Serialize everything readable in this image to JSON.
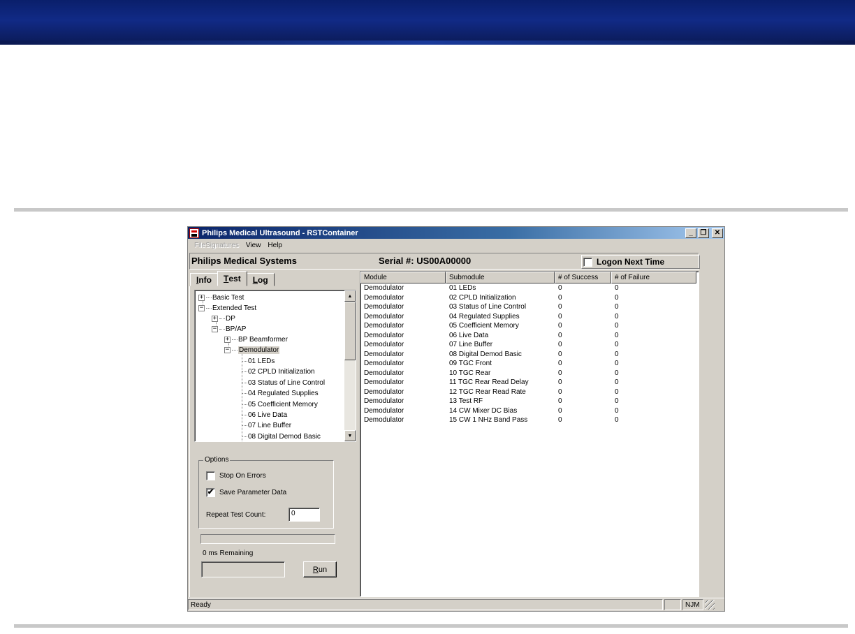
{
  "window": {
    "title": "Philips Medical Ultrasound - RSTContainer",
    "minimize": "_",
    "restore": "❐",
    "close": "✕"
  },
  "menu": {
    "items": [
      "FileSignatures",
      "View",
      "Help"
    ]
  },
  "header": {
    "company": "Philips Medical Systems",
    "serial": "Serial #: US00A00000",
    "logon_label": "Logon Next Time",
    "logon_checked": false
  },
  "tabs": [
    {
      "label": "Info",
      "accel": "I",
      "rest": "nfo",
      "active": false
    },
    {
      "label": "Test",
      "accel": "T",
      "rest": "est",
      "active": true
    },
    {
      "label": "Log",
      "accel": "L",
      "rest": "og",
      "active": false
    }
  ],
  "tree": {
    "nodes": [
      {
        "label": "Basic Test",
        "toggle": "+"
      },
      {
        "label": "Extended Test",
        "toggle": "−"
      },
      {
        "label": "DP",
        "toggle": "+"
      },
      {
        "label": "BP/AP",
        "toggle": "−"
      },
      {
        "label": "BP Beamformer",
        "toggle": "+"
      },
      {
        "label": "Demodulator",
        "toggle": "−"
      },
      {
        "label": "01 LEDs"
      },
      {
        "label": "02 CPLD Initialization"
      },
      {
        "label": "03 Status of Line Control"
      },
      {
        "label": "04 Regulated Supplies"
      },
      {
        "label": "05 Coefficient Memory"
      },
      {
        "label": "06 Live Data"
      },
      {
        "label": "07 Line Buffer"
      },
      {
        "label": "08 Digital Demod Basic"
      }
    ],
    "scroll_up": "▲",
    "scroll_down": "▼"
  },
  "options": {
    "legend": "Options",
    "stop_on_errors": "Stop On Errors",
    "stop_on_errors_checked": false,
    "save_parameter_data": "Save Parameter Data",
    "save_parameter_data_checked": true,
    "check_mark": "✔",
    "repeat_label": "Repeat Test Count:",
    "repeat_value": "0"
  },
  "progress": {
    "remaining": "0 ms Remaining",
    "fraction": 0
  },
  "run_button": {
    "accel": "R",
    "rest": "un"
  },
  "results": {
    "columns": [
      "Module",
      "Submodule",
      "# of Success",
      "# of Failure"
    ],
    "rows": [
      [
        "Demodulator",
        "01 LEDs",
        "0",
        "0"
      ],
      [
        "Demodulator",
        "02 CPLD Initialization",
        "0",
        "0"
      ],
      [
        "Demodulator",
        "03 Status of Line Control",
        "0",
        "0"
      ],
      [
        "Demodulator",
        "04 Regulated Supplies",
        "0",
        "0"
      ],
      [
        "Demodulator",
        "05 Coefficient Memory",
        "0",
        "0"
      ],
      [
        "Demodulator",
        "06 Live Data",
        "0",
        "0"
      ],
      [
        "Demodulator",
        "07 Line Buffer",
        "0",
        "0"
      ],
      [
        "Demodulator",
        "08 Digital Demod Basic",
        "0",
        "0"
      ],
      [
        "Demodulator",
        "09 TGC Front",
        "0",
        "0"
      ],
      [
        "Demodulator",
        "10 TGC Rear",
        "0",
        "0"
      ],
      [
        "Demodulator",
        "11 TGC Rear Read Delay",
        "0",
        "0"
      ],
      [
        "Demodulator",
        "12 TGC Rear Read Rate",
        "0",
        "0"
      ],
      [
        "Demodulator",
        "13 Test RF",
        "0",
        "0"
      ],
      [
        "Demodulator",
        "14 CW Mixer DC Bias",
        "0",
        "0"
      ],
      [
        "Demodulator",
        "15 CW 1 NHz Band Pass",
        "0",
        "0"
      ]
    ]
  },
  "statusbar": {
    "status": "Ready",
    "user": "NJM"
  },
  "colors": {
    "banner": "#0a1f6b",
    "titlebar_start": "#0a246a",
    "titlebar_end": "#a6caf0",
    "face": "#d4d0c8"
  }
}
